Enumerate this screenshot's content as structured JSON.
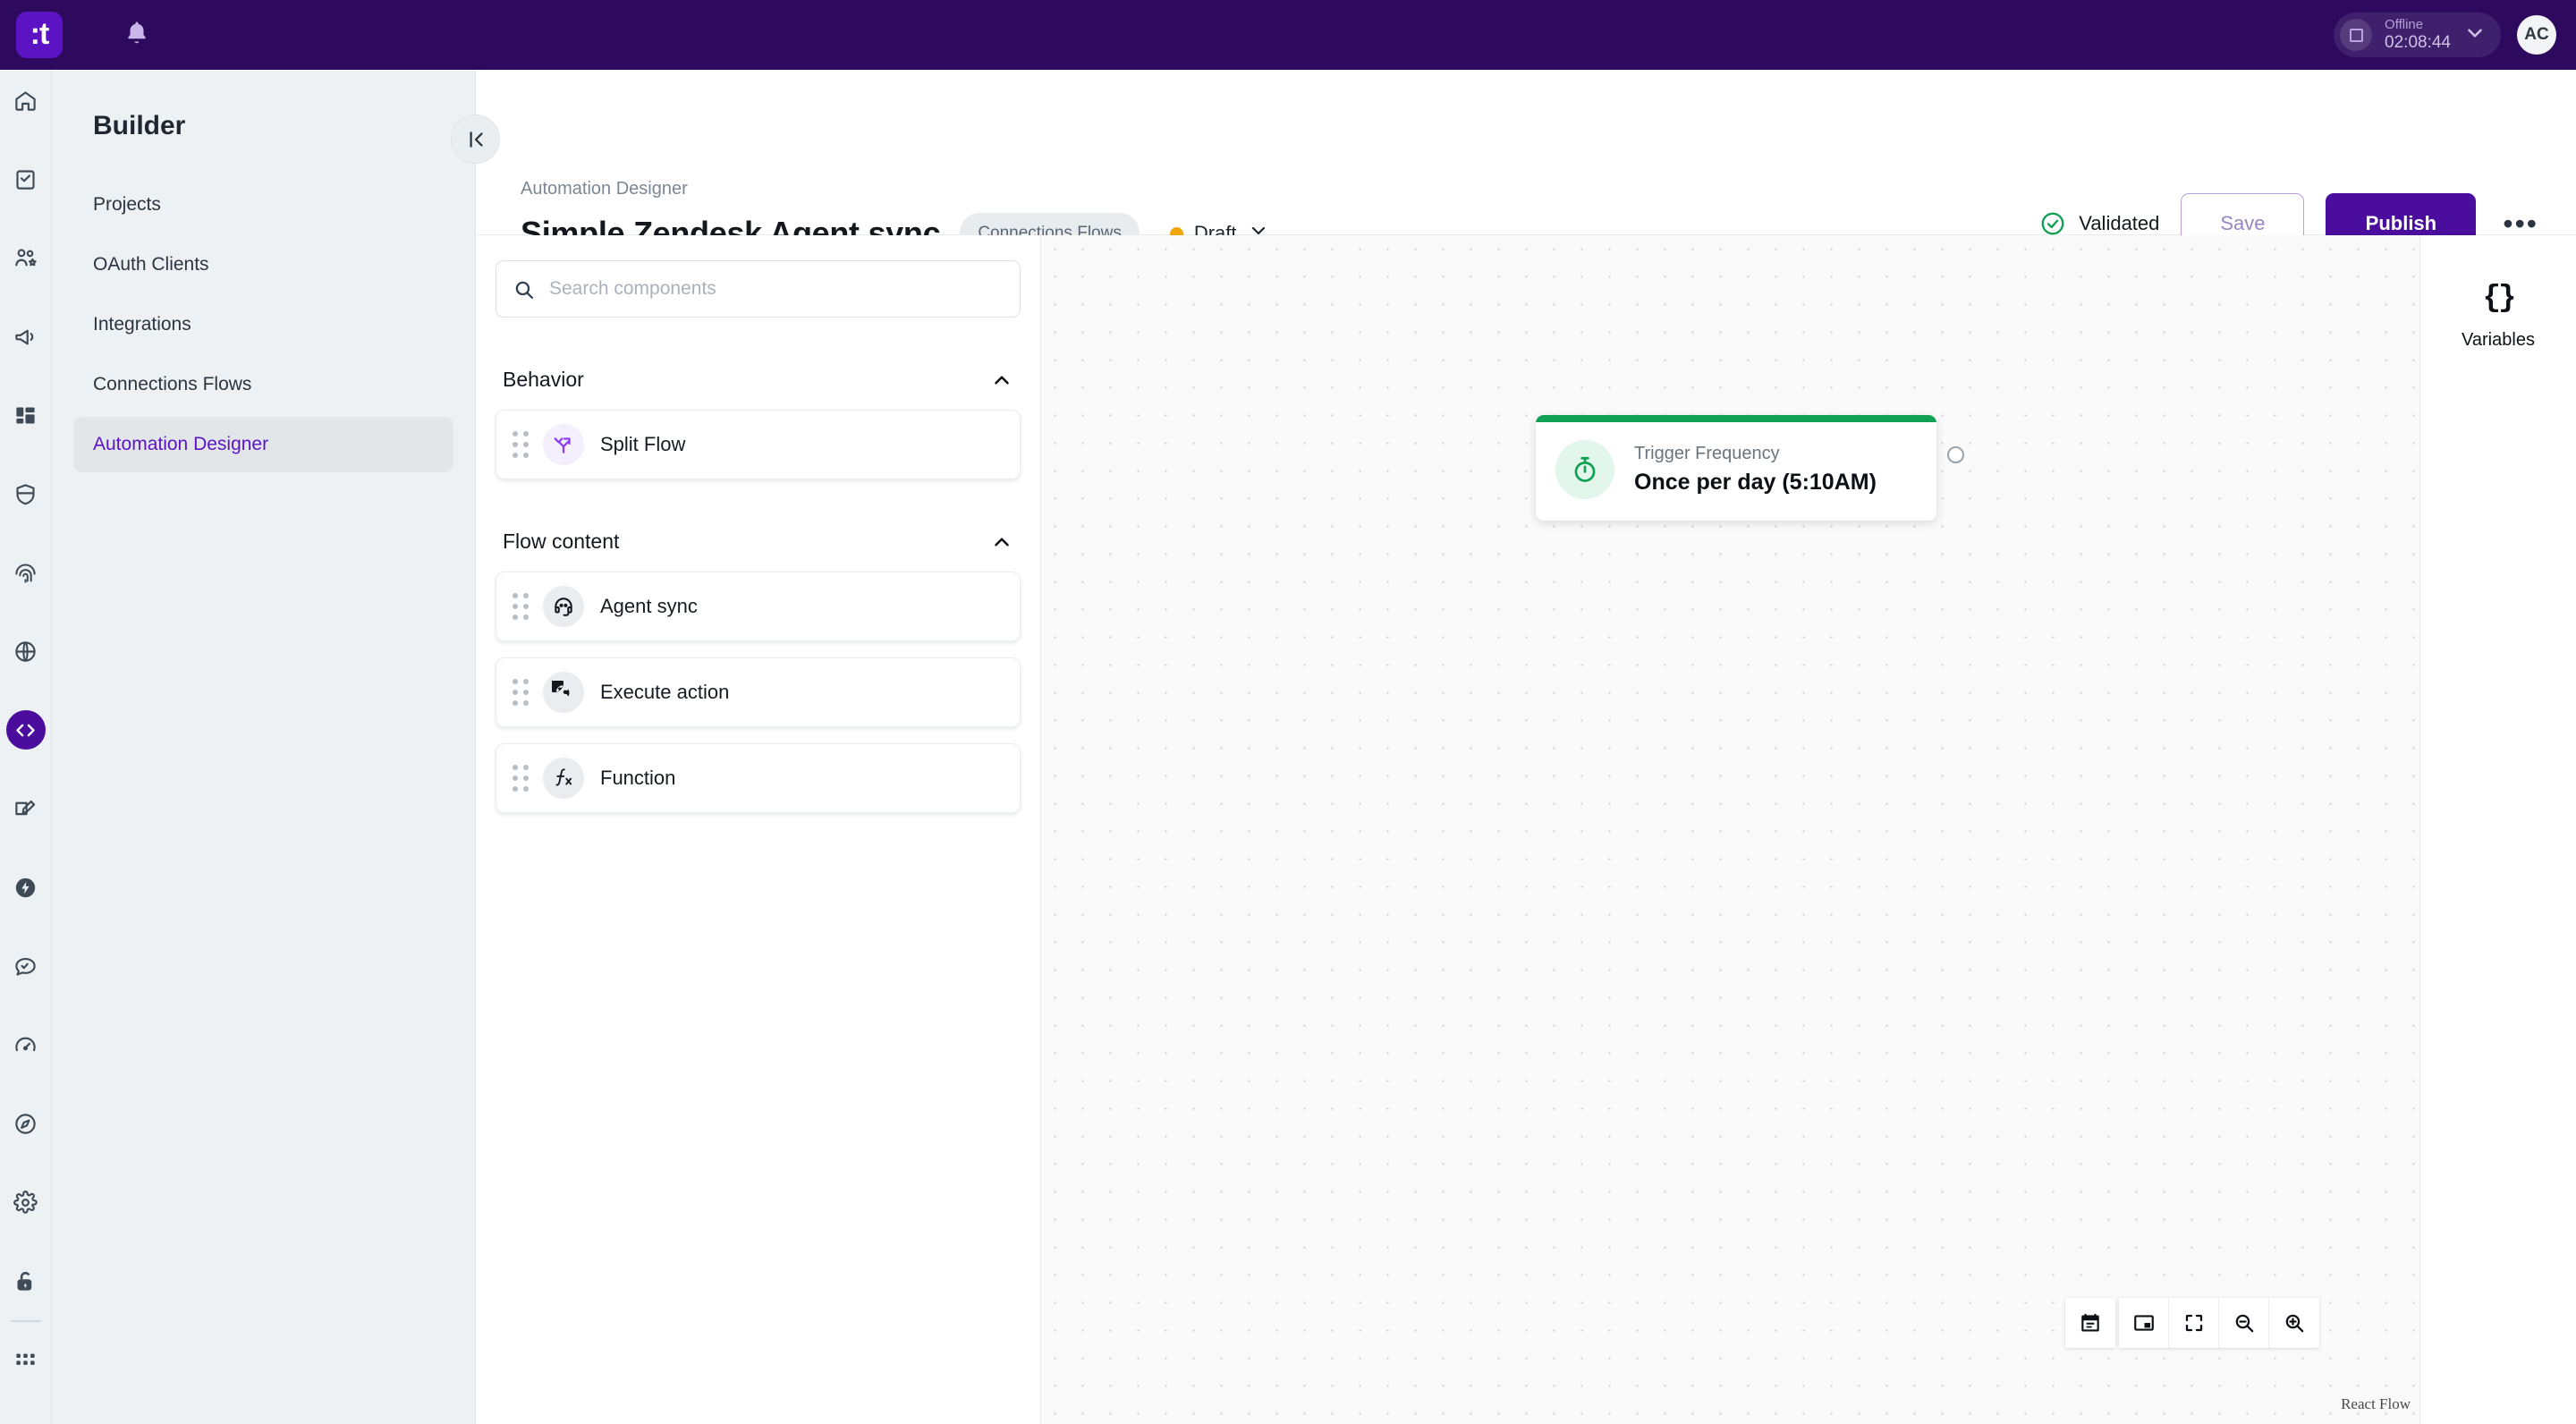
{
  "topbar": {
    "logo_text": ":t",
    "logo_icon": "brand-logo-icon",
    "bell_icon": "notification-bell-icon",
    "status_label": "Offline",
    "status_timer": "02:08:44",
    "status_icon": "stop-square-icon",
    "chevron_icon": "chevron-down-icon",
    "avatar_initials": "AC",
    "brand_color": "#2d0a5e",
    "accent_color": "#4a0d9e"
  },
  "rail": {
    "items": [
      {
        "icon": "home-icon",
        "active": false
      },
      {
        "icon": "clipboard-check-icon",
        "active": false
      },
      {
        "icon": "users-star-icon",
        "active": false
      },
      {
        "icon": "megaphone-icon",
        "active": false
      },
      {
        "icon": "dashboard-layout-icon",
        "active": false
      },
      {
        "icon": "shield-icon",
        "active": false
      },
      {
        "icon": "fingerprint-icon",
        "active": false
      },
      {
        "icon": "globe-icon",
        "active": false
      },
      {
        "icon": "code-brackets-icon",
        "active": true
      },
      {
        "icon": "edit-pencil-icon",
        "active": false
      },
      {
        "icon": "lightning-bolt-icon",
        "active": false
      },
      {
        "icon": "chat-bubble-icon",
        "active": false
      },
      {
        "icon": "speedometer-icon",
        "active": false
      },
      {
        "icon": "compass-icon",
        "active": false
      },
      {
        "icon": "gear-icon",
        "active": false
      },
      {
        "icon": "lock-icon",
        "active": false
      }
    ],
    "footer_icon": "apps-grid-icon"
  },
  "sidebar": {
    "heading": "Builder",
    "items": [
      {
        "label": "Projects",
        "active": false
      },
      {
        "label": "OAuth Clients",
        "active": false
      },
      {
        "label": "Integrations",
        "active": false
      },
      {
        "label": "Connections Flows",
        "active": false
      },
      {
        "label": "Automation Designer",
        "active": true
      }
    ]
  },
  "header": {
    "collapse_icon": "collapse-panel-icon",
    "breadcrumb": "Automation Designer",
    "title": "Simple Zendesk Agent sync",
    "badge": "Connections Flows",
    "status": "Draft",
    "status_color": "#f2a60c",
    "status_chevron_icon": "chevron-down-icon",
    "validated_label": "Validated",
    "validated_icon": "check-circle-icon",
    "validated_color": "#12a055",
    "save_label": "Save",
    "publish_label": "Publish",
    "more_icon": "more-horizontal-icon",
    "more_label": "•••"
  },
  "panel": {
    "search_placeholder": "Search components",
    "search_value": "",
    "search_icon": "search-icon",
    "sections": [
      {
        "title": "Behavior",
        "chevron_icon": "chevron-up-icon",
        "items": [
          {
            "label": "Split Flow",
            "icon": "split-flow-icon",
            "style": "purple"
          }
        ]
      },
      {
        "title": "Flow content",
        "chevron_icon": "chevron-up-icon",
        "items": [
          {
            "label": "Agent sync",
            "icon": "headset-icon",
            "style": "gray"
          },
          {
            "label": "Execute action",
            "icon": "globe-icon",
            "style": "gray"
          },
          {
            "label": "Function",
            "icon": "function-fx-icon",
            "style": "gray"
          }
        ]
      }
    ],
    "drag_handle_icon": "drag-grip-icon"
  },
  "canvas": {
    "node": {
      "label": "Trigger Frequency",
      "value": "Once per day (5:10AM)",
      "icon": "stopwatch-icon",
      "accent_color": "#12a055",
      "handle_name": "node-output-handle"
    },
    "controls": [
      {
        "icon": "calendar-icon",
        "name": "schedule-button"
      },
      {
        "icon": "minimap-icon",
        "name": "toggle-minimap-button"
      },
      {
        "icon": "fit-view-icon",
        "name": "fit-view-button"
      },
      {
        "icon": "zoom-out-icon",
        "name": "zoom-out-button"
      },
      {
        "icon": "zoom-in-icon",
        "name": "zoom-in-button"
      }
    ],
    "attribution": "React Flow"
  },
  "right_panel": {
    "variables_glyph": "{}",
    "variables_label": "Variables",
    "variables_icon": "curly-braces-icon"
  }
}
